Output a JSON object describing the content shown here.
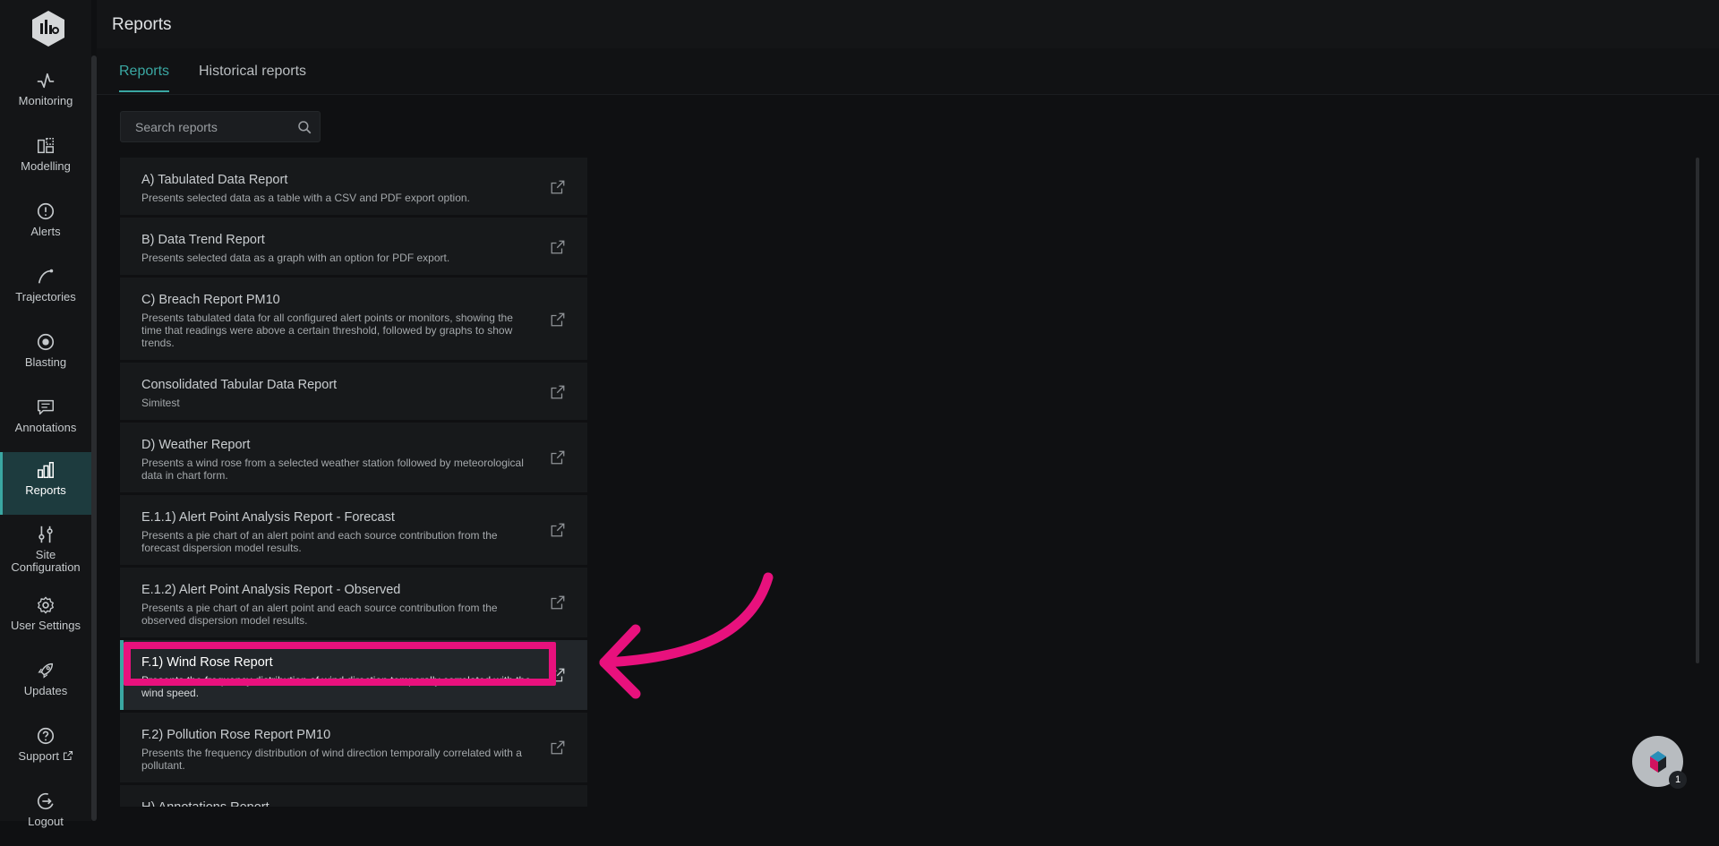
{
  "header": {
    "title": "Reports"
  },
  "tabs": [
    {
      "label": "Reports",
      "active": true
    },
    {
      "label": "Historical reports",
      "active": false
    }
  ],
  "search": {
    "placeholder": "Search reports",
    "value": ""
  },
  "sidebar": {
    "items": [
      {
        "label": "Monitoring",
        "icon": "pulse-icon",
        "active": false
      },
      {
        "label": "Modelling",
        "icon": "layout-icon",
        "active": false
      },
      {
        "label": "Alerts",
        "icon": "alert-circle-icon",
        "active": false
      },
      {
        "label": "Trajectories",
        "icon": "curve-icon",
        "active": false
      },
      {
        "label": "Blasting",
        "icon": "target-icon",
        "active": false
      },
      {
        "label": "Annotations",
        "icon": "comment-icon",
        "active": false
      },
      {
        "label": "Reports",
        "icon": "bar-chart-icon",
        "active": true
      },
      {
        "label": "Site Configuration",
        "icon": "sliders-icon",
        "active": false
      },
      {
        "label": "User Settings",
        "icon": "gear-icon",
        "active": false
      },
      {
        "label": "Updates",
        "icon": "rocket-icon",
        "active": false
      },
      {
        "label": "Support",
        "icon": "help-circle-icon",
        "active": false
      },
      {
        "label": "Logout",
        "icon": "logout-icon",
        "active": false
      }
    ]
  },
  "reports": [
    {
      "title": "A) Tabulated Data Report",
      "description": "Presents selected data as a table with a CSV and PDF export option."
    },
    {
      "title": "B) Data Trend Report",
      "description": "Presents selected data as a graph with an option for PDF export."
    },
    {
      "title": "C) Breach Report PM10",
      "description": "Presents tabulated data for all configured alert points or monitors, showing the time that readings were above a certain threshold, followed by graphs to show trends."
    },
    {
      "title": "Consolidated Tabular Data Report",
      "description": "Simitest"
    },
    {
      "title": "D) Weather Report",
      "description": "Presents a wind rose from a selected weather station followed by meteorological data in chart form."
    },
    {
      "title": "E.1.1) Alert Point Analysis Report - Forecast",
      "description": "Presents a pie chart of an alert point and each source contribution from the forecast dispersion model results."
    },
    {
      "title": "E.1.2) Alert Point Analysis Report - Observed",
      "description": "Presents a pie chart of an alert point and each source contribution from the observed dispersion model results."
    },
    {
      "title": "F.1) Wind Rose Report",
      "description": "Presents the frequency distribution of wind direction temporally correlated with the wind speed.",
      "highlighted": true
    },
    {
      "title": "F.2) Pollution Rose Report PM10",
      "description": "Presents the frequency distribution of wind direction temporally correlated with a pollutant."
    },
    {
      "title": "H) Annotations Report",
      "description": ""
    }
  ],
  "chat": {
    "badge": "1"
  },
  "colors": {
    "accent": "#3aa7a2",
    "annotation": "#e8117d"
  }
}
